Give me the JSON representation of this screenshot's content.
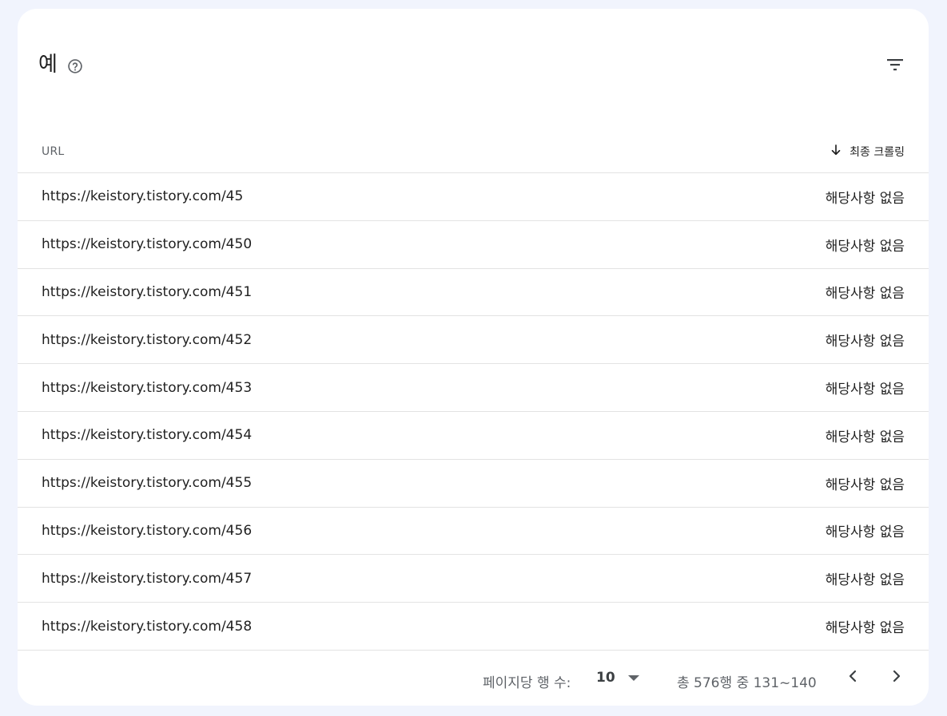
{
  "card": {
    "title": "예"
  },
  "table": {
    "columns": {
      "url": "URL",
      "last_crawl": "최종 크롤링"
    },
    "rows": [
      {
        "url": "https://keistory.tistory.com/45",
        "last_crawl": "해당사항 없음"
      },
      {
        "url": "https://keistory.tistory.com/450",
        "last_crawl": "해당사항 없음"
      },
      {
        "url": "https://keistory.tistory.com/451",
        "last_crawl": "해당사항 없음"
      },
      {
        "url": "https://keistory.tistory.com/452",
        "last_crawl": "해당사항 없음"
      },
      {
        "url": "https://keistory.tistory.com/453",
        "last_crawl": "해당사항 없음"
      },
      {
        "url": "https://keistory.tistory.com/454",
        "last_crawl": "해당사항 없음"
      },
      {
        "url": "https://keistory.tistory.com/455",
        "last_crawl": "해당사항 없음"
      },
      {
        "url": "https://keistory.tistory.com/456",
        "last_crawl": "해당사항 없음"
      },
      {
        "url": "https://keistory.tistory.com/457",
        "last_crawl": "해당사항 없음"
      },
      {
        "url": "https://keistory.tistory.com/458",
        "last_crawl": "해당사항 없음"
      }
    ]
  },
  "pagination": {
    "rows_per_page_label": "페이지당 행 수:",
    "rows_per_page_value": "10",
    "range_text": "총 576행 중 131~140"
  },
  "icons": {
    "help": "help-circle-icon",
    "filter": "filter-icon",
    "sort": "arrow-down-icon",
    "prev": "chevron-left-icon",
    "next": "chevron-right-icon"
  }
}
